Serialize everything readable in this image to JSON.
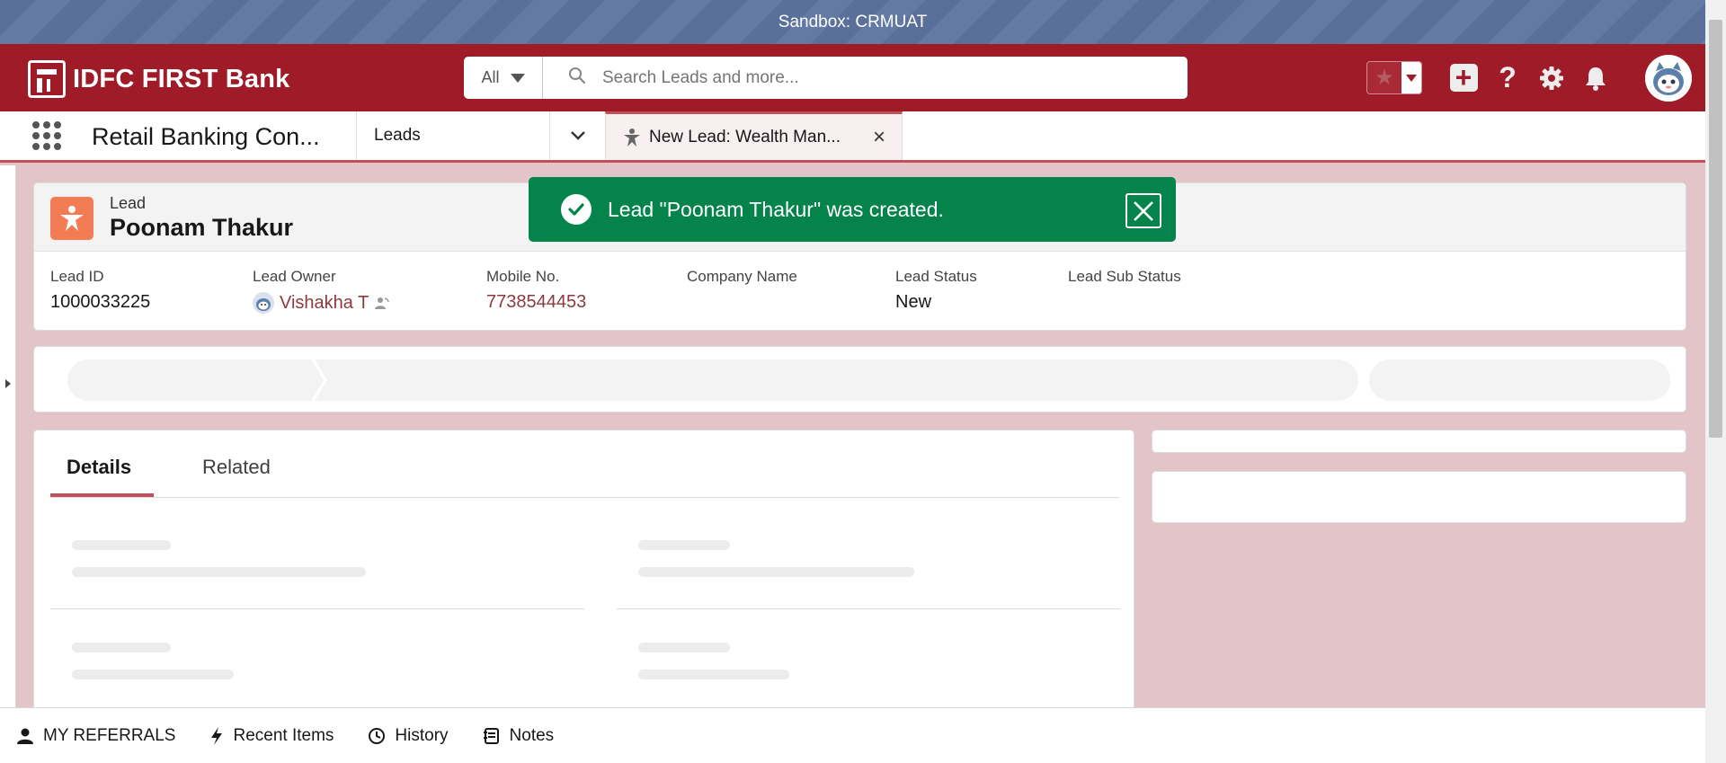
{
  "sandbox": {
    "label": "Sandbox: CRMUAT"
  },
  "header": {
    "brand": "IDFC FIRST Bank",
    "search_scope": "All",
    "search_placeholder": "Search Leads and more..."
  },
  "nav": {
    "app_name": "Retail Banking Con...",
    "object_tab": "Leads",
    "active_tab": "New Lead: Wealth Man..."
  },
  "toast": {
    "message": "Lead \"Poonam Thakur\" was created."
  },
  "record": {
    "object_label": "Lead",
    "name": "Poonam Thakur",
    "fields": [
      {
        "label": "Lead ID",
        "value": "1000033225"
      },
      {
        "label": "Lead Owner",
        "value": "Vishakha T"
      },
      {
        "label": "Mobile No.",
        "value": "7738544453"
      },
      {
        "label": "Company Name",
        "value": ""
      },
      {
        "label": "Lead Status",
        "value": "New"
      },
      {
        "label": "Lead Sub Status",
        "value": ""
      }
    ]
  },
  "detail_tabs": {
    "details": "Details",
    "related": "Related"
  },
  "utility_bar": {
    "referrals": "MY REFERRALS",
    "recent": "Recent Items",
    "history": "History",
    "notes": "Notes"
  },
  "colors": {
    "brand_red": "#9e1b27",
    "toast_green": "#04844b",
    "lead_icon": "#f37c55",
    "page_background": "#e3c4c9"
  },
  "icons": [
    "search-icon",
    "star-icon",
    "plus-icon",
    "help-icon",
    "gear-icon",
    "bell-icon",
    "app-launcher-icon",
    "chevron-down-icon",
    "close-icon",
    "lead-icon",
    "check-icon",
    "user-icon",
    "bolt-icon",
    "clock-icon",
    "notes-icon"
  ]
}
